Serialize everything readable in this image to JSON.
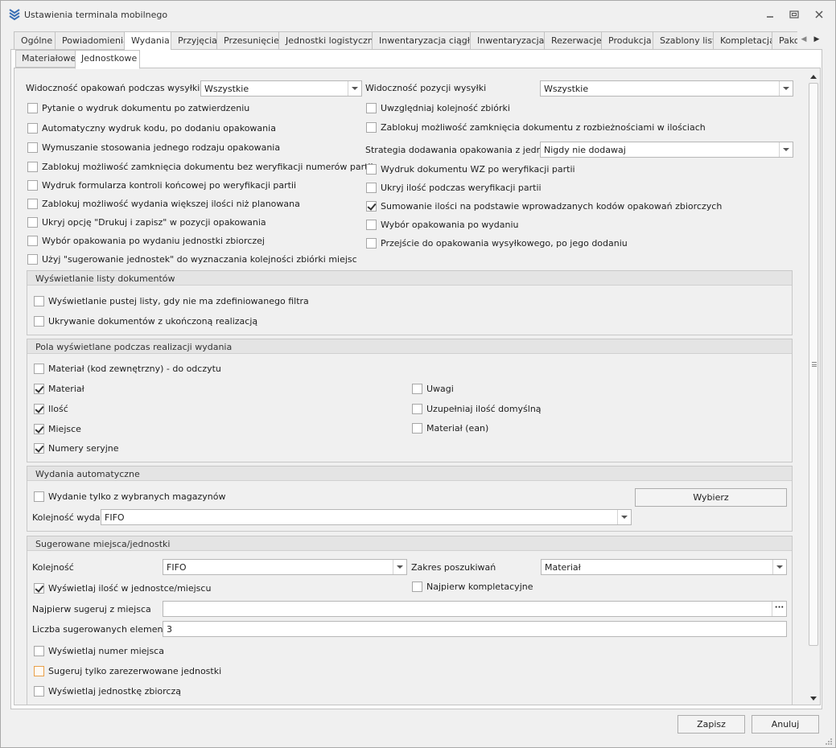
{
  "window": {
    "title": "Ustawienia terminala mobilnego",
    "app_icon": "layers-chevron-icon",
    "minimize_icon": "minimize-icon",
    "maximize_icon": "restore-icon",
    "close_icon": "close-icon"
  },
  "tabs": [
    {
      "label": "Ogólne"
    },
    {
      "label": "Powiadomienia"
    },
    {
      "label": "Wydania",
      "active": true
    },
    {
      "label": "Przyjęcia"
    },
    {
      "label": "Przesunięcie"
    },
    {
      "label": "Jednostki logistyczne"
    },
    {
      "label": "Inwentaryzacja ciągła"
    },
    {
      "label": "Inwentaryzacja"
    },
    {
      "label": "Rezerwacje"
    },
    {
      "label": "Produkcja"
    },
    {
      "label": "Szablony list"
    },
    {
      "label": "Kompletacja"
    },
    {
      "label": "Pako"
    }
  ],
  "subtabs": [
    {
      "label": "Materiałowe"
    },
    {
      "label": "Jednostkowe",
      "active": true
    }
  ],
  "top": {
    "widocznosc_opakowan_label": "Widoczność opakowań podczas wysyłki",
    "widocznosc_opakowan_value": "Wszystkie",
    "widocznosc_pozycji_label": "Widoczność pozycji wysyłki",
    "widocznosc_pozycji_value": "Wszystkie",
    "strategia_label": "Strategia dodawania opakowania z jednostki",
    "strategia_value": "Nigdy nie dodawaj",
    "left_checks": [
      {
        "label": "Pytanie o wydruk dokumentu po zatwierdzeniu",
        "checked": false
      },
      {
        "label": "Automatyczny wydruk kodu, po dodaniu opakowania",
        "checked": false
      },
      {
        "label": "Wymuszanie stosowania jednego rodzaju opakowania",
        "checked": false
      },
      {
        "label": "Zablokuj możliwość zamknięcia dokumentu bez weryfikacji numerów partii",
        "checked": false
      },
      {
        "label": "Wydruk formularza kontroli końcowej po weryfikacji partii",
        "checked": false
      },
      {
        "label": "Zablokuj możliwość wydania większej ilości niż planowana",
        "checked": false
      },
      {
        "label": "Ukryj opcję \"Drukuj i zapisz\" w pozycji opakowania",
        "checked": false
      },
      {
        "label": "Wybór opakowania po wydaniu jednostki zbiorczej",
        "checked": false
      },
      {
        "label": "Użyj \"sugerowanie jednostek\" do wyznaczania kolejności zbiórki miejsc",
        "checked": false
      }
    ],
    "right_checks_a": [
      {
        "label": "Uwzględniaj kolejność zbiórki",
        "checked": false
      },
      {
        "label": "Zablokuj możliwość zamknięcia dokumentu z rozbieżnościami w ilościach",
        "checked": false
      }
    ],
    "right_checks_b": [
      {
        "label": "Wydruk dokumentu WZ po weryfikacji partii",
        "checked": false
      },
      {
        "label": "Ukryj ilość podczas weryfikacji partii",
        "checked": false
      },
      {
        "label": "Sumowanie ilości na podstawie wprowadzanych kodów opakowań zbiorczych",
        "checked": true
      },
      {
        "label": "Wybór opakowania po wydaniu",
        "checked": false
      },
      {
        "label": "Przejście do opakowania wysyłkowego, po jego dodaniu",
        "checked": false
      }
    ]
  },
  "group_lista": {
    "title": "Wyświetlanie listy dokumentów",
    "checks": [
      {
        "label": "Wyświetlanie pustej listy, gdy nie ma zdefiniowanego filtra",
        "checked": false
      },
      {
        "label": "Ukrywanie dokumentów z ukończoną realizacją",
        "checked": false
      }
    ]
  },
  "group_pola": {
    "title": "Pola wyświetlane podczas realizacji wydania",
    "first": {
      "label": "Materiał (kod zewnętrzny) - do odczytu",
      "checked": false
    },
    "left": [
      {
        "label": "Materiał",
        "checked": true
      },
      {
        "label": "Ilość",
        "checked": true
      },
      {
        "label": "Miejsce",
        "checked": true
      },
      {
        "label": "Numery seryjne",
        "checked": true
      }
    ],
    "right": [
      {
        "label": "Uwagi",
        "checked": false
      },
      {
        "label": "Uzupełniaj ilość domyślną",
        "checked": false
      },
      {
        "label": "Materiał (ean)",
        "checked": false
      }
    ]
  },
  "group_auto": {
    "title": "Wydania automatyczne",
    "check": {
      "label": "Wydanie tylko z wybranych magazynów",
      "checked": false
    },
    "button": "Wybierz",
    "kolejnosc_label": "Kolejność wydań",
    "kolejnosc_value": "FIFO"
  },
  "group_sug": {
    "title": "Sugerowane miejsca/jednostki",
    "kolejnosc_label": "Kolejność",
    "kolejnosc_value": "FIFO",
    "zakres_label": "Zakres poszukiwań",
    "zakres_value": "Materiał",
    "ilosc_check": {
      "label": "Wyświetlaj ilość w jednostce/miejscu",
      "checked": true
    },
    "najpierw_komp": {
      "label": "Najpierw kompletacyjne",
      "checked": false
    },
    "najpierw_label": "Najpierw sugeruj z miejsca",
    "najpierw_value": "",
    "ellipsis": "···",
    "liczba_label": "Liczba sugerowanych elementów",
    "liczba_value": "3",
    "checks": [
      {
        "label": "Wyświetlaj numer miejsca",
        "checked": false
      },
      {
        "label": "Sugeruj tylko zarezerwowane jednostki",
        "checked": false
      },
      {
        "label": "Wyświetlaj jednostkę zbiorczą",
        "checked": false
      }
    ]
  },
  "footer": {
    "save": "Zapisz",
    "cancel": "Anuluj"
  }
}
